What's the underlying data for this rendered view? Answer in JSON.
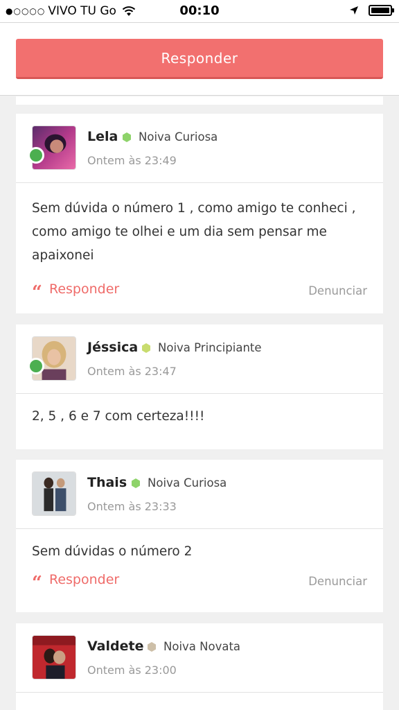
{
  "status_bar": {
    "carrier": "VIVO TU Go",
    "time": "00:10"
  },
  "header": {
    "reply_label": "Responder"
  },
  "comments": [
    {
      "name": "Lela",
      "rank": "Noiva Curiosa",
      "time": "Ontem às 23:49",
      "text": "Sem dúvida o número 1 , como amigo te conheci , como amigo te olhei e um dia sem pensar me apaixonei",
      "reply_label": "Responder",
      "report_label": "Denunciar"
    },
    {
      "name": "Jéssica",
      "rank": "Noiva Principiante",
      "time": "Ontem às 23:47",
      "text": "2, 5 , 6 e 7 com certeza!!!!"
    },
    {
      "name": "Thais",
      "rank": "Noiva Curiosa",
      "time": "Ontem às 23:33",
      "text": "Sem dúvidas o número 2",
      "reply_label": "Responder",
      "report_label": "Denunciar"
    },
    {
      "name": "Valdete",
      "rank": "Noiva Novata",
      "time": "Ontem às 23:00"
    }
  ],
  "colors": {
    "accent": "#f2706f",
    "online": "#4caf50",
    "rank_green": "#8ed36a",
    "rank_light_green": "#c8dc6e",
    "rank_beige": "#cdbfa8"
  },
  "icons": {
    "quote": "quote-icon",
    "rank": "hexagon-icon"
  }
}
